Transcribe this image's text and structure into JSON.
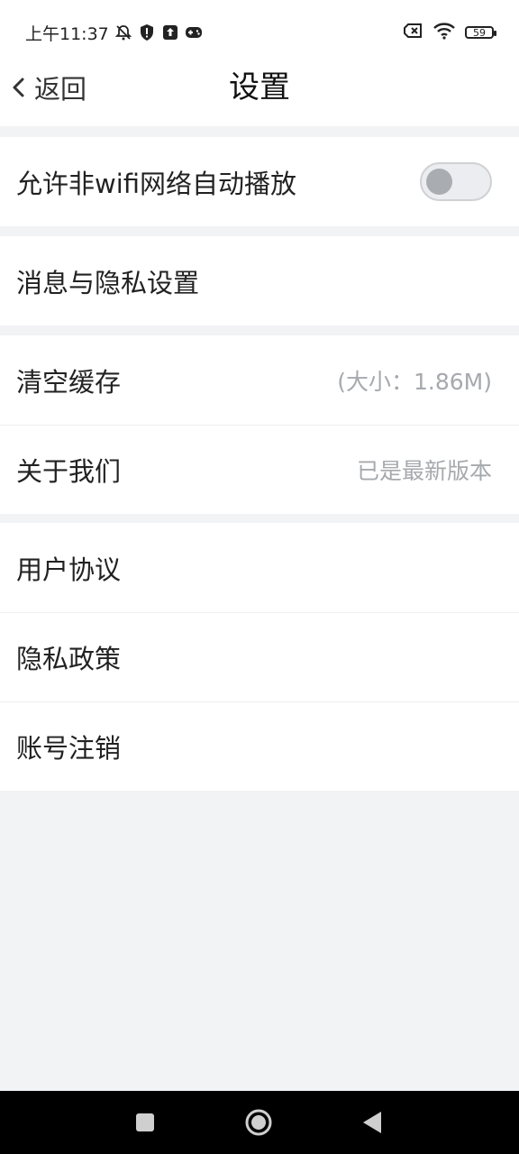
{
  "status_bar": {
    "time": "上午11:37",
    "battery": "59",
    "left_icons": [
      "bell-off-icon",
      "shield-alert-icon",
      "upload-icon",
      "gamepad-icon"
    ],
    "right_icons": [
      "sim-error-icon",
      "wifi-icon",
      "battery-icon"
    ]
  },
  "header": {
    "back_label": "返回",
    "title": "设置"
  },
  "settings": {
    "autoplay": {
      "label": "允许非wifi网络自动播放",
      "enabled": false
    },
    "privacy": {
      "label": "消息与隐私设置"
    },
    "clear_cache": {
      "label": "清空缓存",
      "value": "(大小：1.86M)"
    },
    "about": {
      "label": "关于我们",
      "value": "已是最新版本"
    },
    "user_agreement": {
      "label": "用户协议"
    },
    "privacy_policy": {
      "label": "隐私政策"
    },
    "account_cancel": {
      "label": "账号注销"
    }
  },
  "system_nav": [
    "recents-icon",
    "home-icon",
    "back-triangle-icon"
  ],
  "colors": {
    "background": "#f2f3f5",
    "card": "#ffffff",
    "secondary_text": "#a6a9ad",
    "toggle_off": "#a9acb0"
  }
}
